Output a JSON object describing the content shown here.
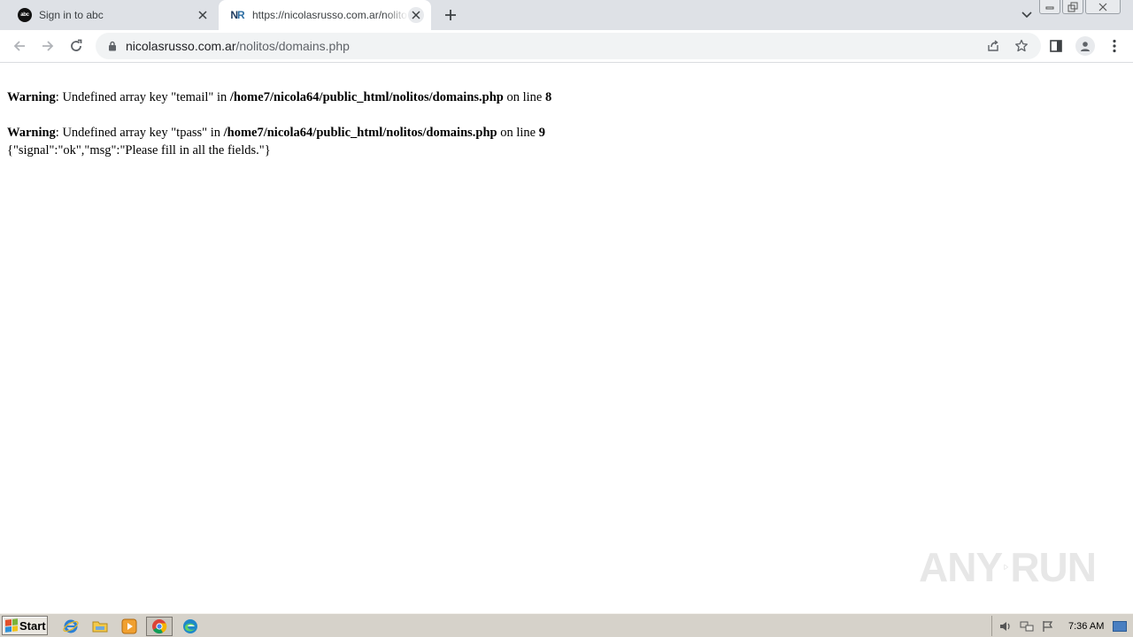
{
  "browser": {
    "tabs": [
      {
        "favicon": "abc-logo",
        "title": "Sign in to abc",
        "active": false
      },
      {
        "favicon": "nr-logo",
        "title": "https://nicolasrusso.com.ar/nolitos/domains.php",
        "active": true
      }
    ],
    "address": {
      "host": "nicolasrusso.com.ar",
      "path": "/nolitos/domains.php"
    },
    "icons": {
      "back": "arrow-left-icon",
      "forward": "arrow-right-icon",
      "reload": "reload-icon",
      "lock": "lock-icon",
      "share": "share-icon",
      "bookmark": "star-icon",
      "side_panel": "side-panel-icon",
      "profile": "profile-icon",
      "menu": "kebab-menu-icon"
    }
  },
  "page": {
    "warnings": [
      {
        "label": "Warning",
        "text_before": ": Undefined array key \"temail\" in ",
        "file": "/home7/nicola64/public_html/nolitos/domains.php",
        "text_mid": " on line ",
        "line": "8"
      },
      {
        "label": "Warning",
        "text_before": ": Undefined array key \"tpass\" in ",
        "file": "/home7/nicola64/public_html/nolitos/domains.php",
        "text_mid": " on line ",
        "line": "9"
      }
    ],
    "json_output": "{\"signal\":\"ok\",\"msg\":\"Please fill in all the fields.\"}"
  },
  "watermark": {
    "left": "ANY",
    "right": "RUN"
  },
  "taskbar": {
    "start_label": "Start",
    "apps": [
      "internet-explorer-icon",
      "file-explorer-icon",
      "media-player-icon",
      "chrome-icon",
      "edge-icon"
    ],
    "clock": "7:36 AM"
  }
}
